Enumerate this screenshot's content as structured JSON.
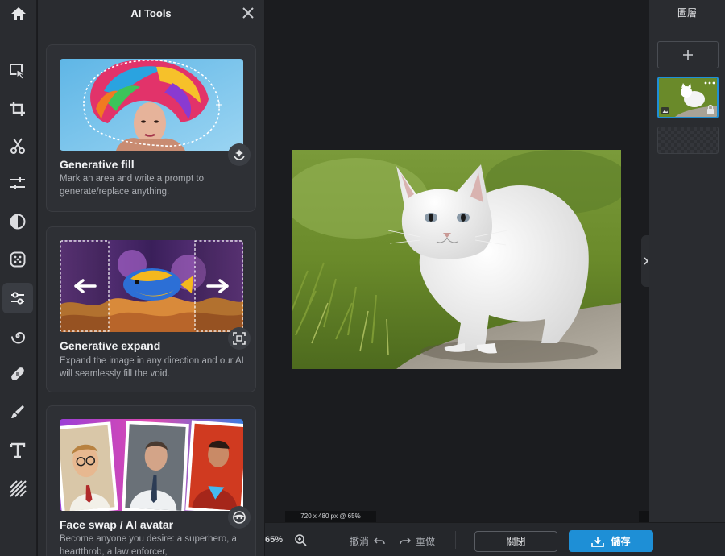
{
  "panel": {
    "title": "AI Tools",
    "cards": [
      {
        "title": "Generative fill",
        "description": "Mark an area and write a prompt to generate/replace anything.",
        "badge_icon": "hand-sparkle-icon"
      },
      {
        "title": "Generative expand",
        "description": "Expand the image in any direction and our AI will seamlessly fill the void.",
        "badge_icon": "expand-frame-icon"
      },
      {
        "title": "Face swap / AI avatar",
        "description": "Become anyone you desire: a superhero, a heartthrob, a law enforcer,",
        "badge_icon": "face-icon"
      }
    ]
  },
  "canvas": {
    "dimensions_label": "720 x 480 px @ 65%"
  },
  "bottombar": {
    "zoom": "65%",
    "undo_label": "撤消",
    "redo_label": "重做",
    "close_label": "關閉",
    "save_label": "儲存"
  },
  "layers": {
    "title": "圖層"
  },
  "colors": {
    "accent": "#1e8fd6",
    "panel_bg": "#2a2c30",
    "canvas_bg": "#1b1c1f"
  }
}
